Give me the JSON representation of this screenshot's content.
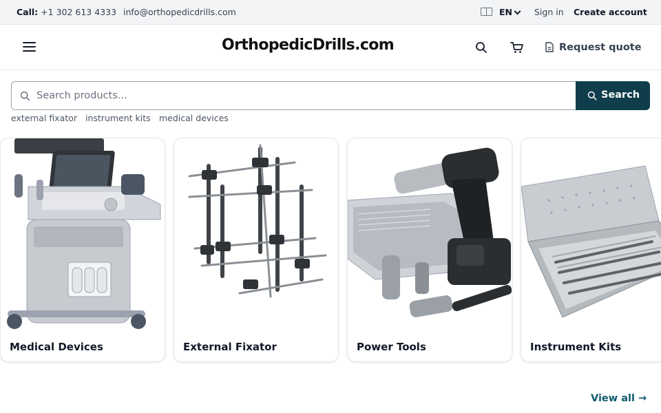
{
  "topbar": {
    "contact_label": "Call:",
    "contact_phone": "+1 302 613 4333",
    "email": "info@orthopedicdrills.com",
    "language": "EN",
    "sign_in": "Sign in",
    "create_account": "Create account"
  },
  "header": {
    "logo": "OrthopedicDrills.com",
    "request_quote": "Request quote"
  },
  "search": {
    "placeholder": "Search products...",
    "value": "",
    "button_label": "Search",
    "suggestions": [
      "external fixator",
      "instrument kits",
      "medical devices"
    ]
  },
  "categories": [
    {
      "title": "Medical Devices",
      "icon": "ultrasound-machine"
    },
    {
      "title": "External Fixator",
      "icon": "external-fixator-frame"
    },
    {
      "title": "Power Tools",
      "icon": "surgical-drill"
    },
    {
      "title": "Instrument Kits",
      "icon": "instrument-tray"
    }
  ],
  "view_all": "View all →",
  "colors": {
    "primary": "#0f3d4c",
    "link": "#0f5a6e",
    "topbar_bg": "#f3f4f6"
  }
}
